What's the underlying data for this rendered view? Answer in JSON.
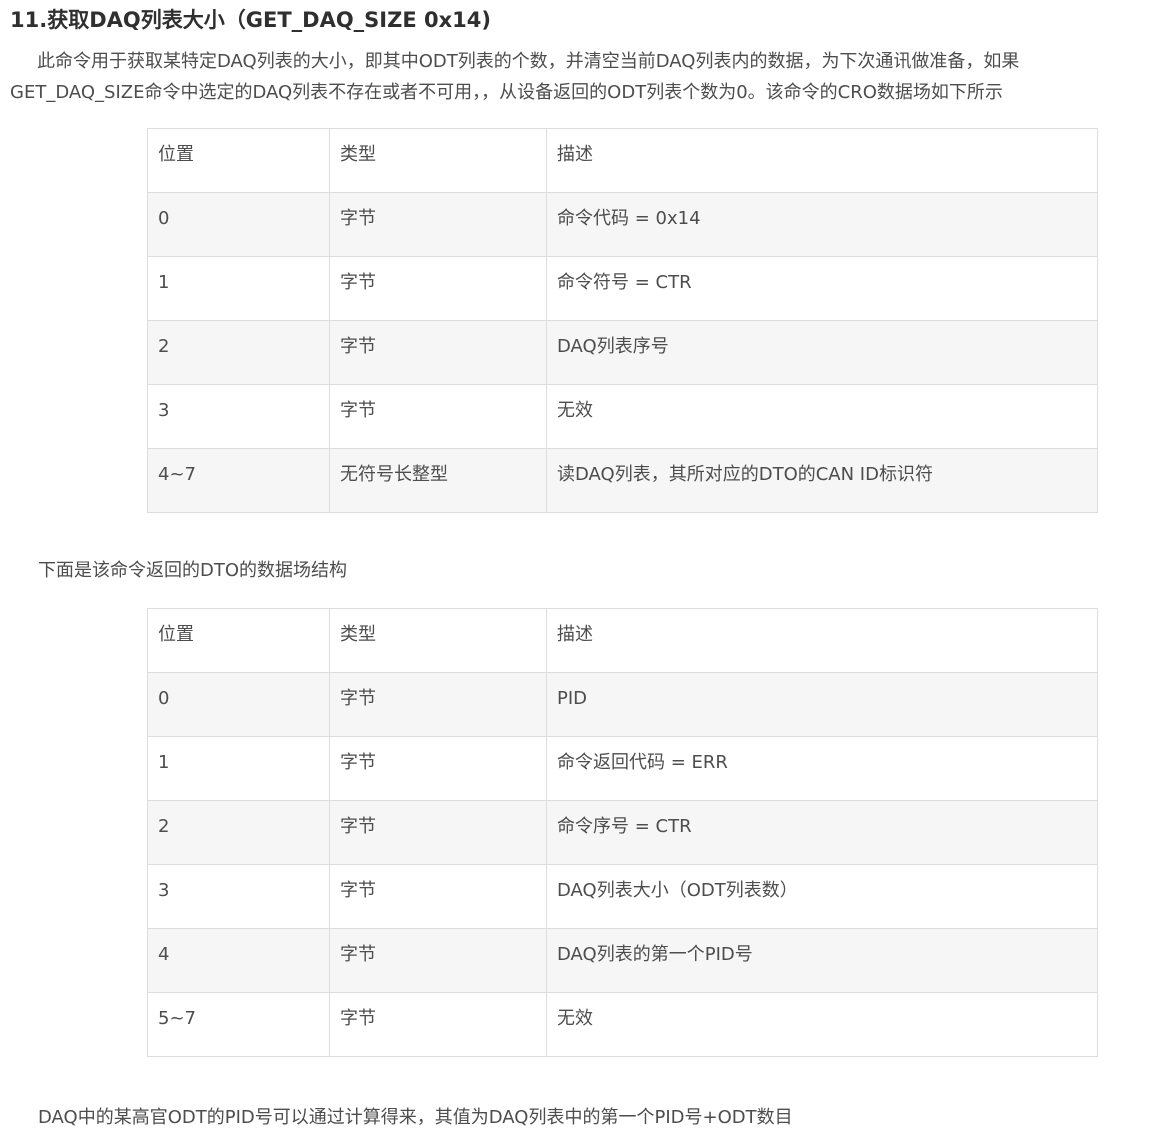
{
  "title": "11.获取DAQ列表大小（GET_DAQ_SIZE 0x14)",
  "intro": {
    "line1": "此命令用于获取某特定DAQ列表的大小，即其中ODT列表的个数，并清空当前DAQ列表内的数据，为下次通讯做准备，如果",
    "line2": "GET_DAQ_SIZE命令中选定的DAQ列表不存在或者不可用，，从设备返回的ODT列表个数为0。该命令的CRO数据场如下所示"
  },
  "cro_table": {
    "headers": [
      "位置",
      "类型",
      "描述"
    ],
    "rows": [
      [
        "0",
        "字节",
        "命令代码 = 0x14"
      ],
      [
        "1",
        "字节",
        "命令符号 = CTR"
      ],
      [
        "2",
        "字节",
        "DAQ列表序号"
      ],
      [
        "3",
        "字节",
        "无效"
      ],
      [
        "4~7",
        "无符号长整型",
        "读DAQ列表，其所对应的DTO的CAN ID标识符"
      ]
    ]
  },
  "dto_heading": "下面是该命令返回的DTO的数据场结构",
  "dto_table": {
    "headers": [
      "位置",
      "类型",
      "描述"
    ],
    "rows": [
      [
        "0",
        "字节",
        "PID"
      ],
      [
        "1",
        "字节",
        "命令返回代码 = ERR"
      ],
      [
        "2",
        "字节",
        "命令序号 = CTR"
      ],
      [
        "3",
        "字节",
        "DAQ列表大小（ODT列表数）"
      ],
      [
        "4",
        "字节",
        "DAQ列表的第一个PID号"
      ],
      [
        "5~7",
        "字节",
        "无效"
      ]
    ]
  },
  "footer": "DAQ中的某高官ODT的PID号可以通过计算得来，其值为DAQ列表中的第一个PID号+ODT数目"
}
